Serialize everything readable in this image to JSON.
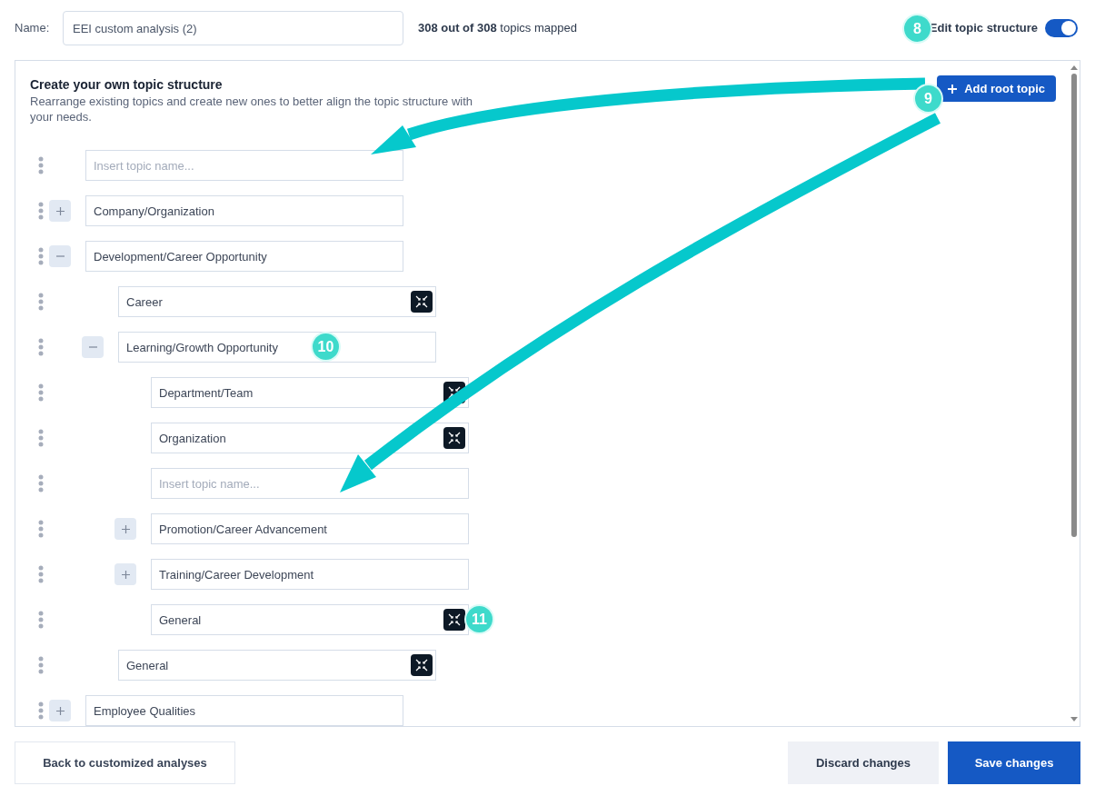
{
  "name_field": {
    "label": "Name:",
    "value": "EEI custom analysis (2)"
  },
  "mapped_summary": "**308 out of 308** topics mapped",
  "edit_toggle": {
    "label": "Edit topic structure",
    "on": true
  },
  "panel": {
    "title": "Create your own topic structure",
    "description": "Rearrange existing topics and create new ones to better align the topic structure with your needs.",
    "add_button": "Add root topic"
  },
  "topics": [
    {
      "kind": "placeholder",
      "placeholder": "Insert topic name..."
    },
    {
      "kind": "topic",
      "label": "Company/Organization",
      "expanded": false
    },
    {
      "kind": "topic",
      "label": "Development/Career Opportunity",
      "expanded": true,
      "children": [
        {
          "kind": "leaf",
          "label": "Career"
        },
        {
          "kind": "topic",
          "label": "Learning/Growth Opportunity",
          "expanded": true,
          "children": [
            {
              "kind": "leaf",
              "label": "Department/Team"
            },
            {
              "kind": "leaf",
              "label": "Organization"
            },
            {
              "kind": "placeholder",
              "placeholder": "Insert topic name..."
            },
            {
              "kind": "topic",
              "label": "Promotion/Career Advancement",
              "expanded": false
            },
            {
              "kind": "topic",
              "label": "Training/Career Development",
              "expanded": false
            },
            {
              "kind": "leaf",
              "label": "General"
            }
          ]
        },
        {
          "kind": "leaf",
          "label": "General"
        }
      ]
    },
    {
      "kind": "topic",
      "label": "Employee Qualities",
      "expanded": false
    }
  ],
  "footer": {
    "back_button": "Back to customized analyses",
    "discard_button": "Discard changes",
    "save_button": "Save changes"
  },
  "annotations": [
    {
      "label": "8"
    },
    {
      "label": "9"
    },
    {
      "label": "10"
    },
    {
      "label": "11"
    }
  ]
}
